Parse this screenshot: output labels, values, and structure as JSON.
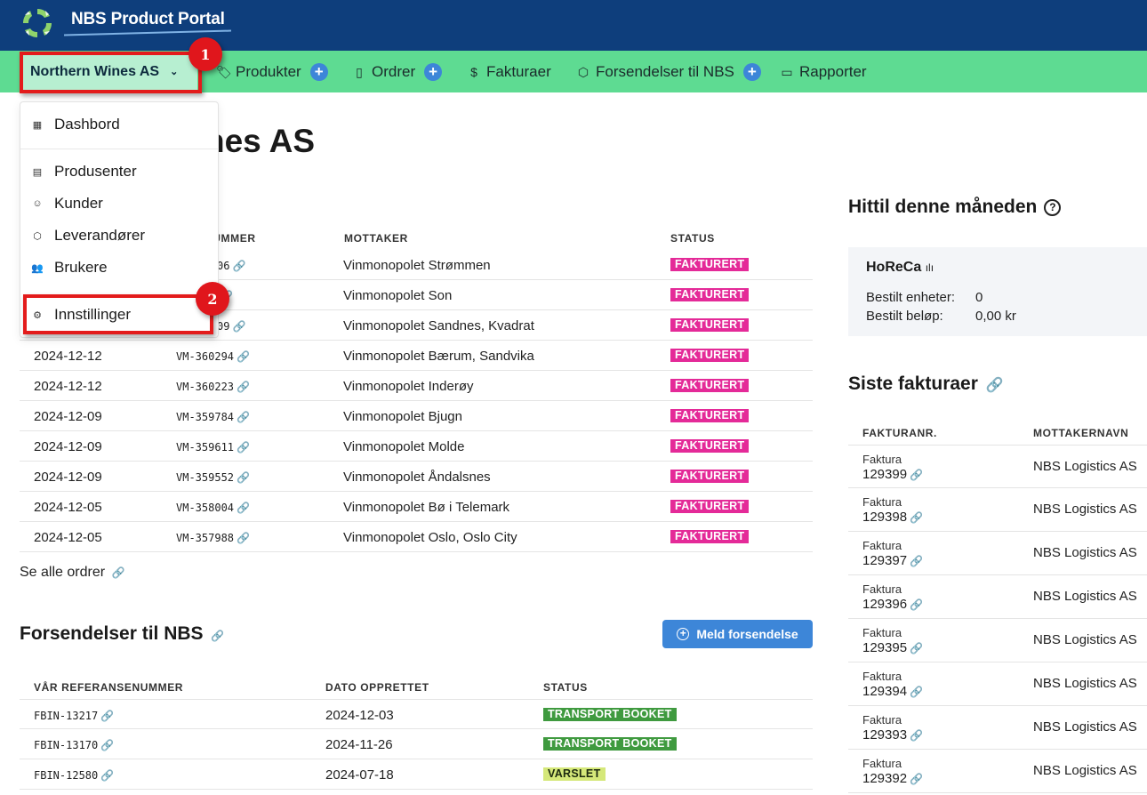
{
  "app": {
    "title": "NBS Product Portal"
  },
  "nav": {
    "org_selector": "Northern Wines AS",
    "items": [
      {
        "label": "Produkter",
        "icon": "tag-icon",
        "has_add": true
      },
      {
        "label": "Ordrer",
        "icon": "clipboard-icon",
        "has_add": true
      },
      {
        "label": "Fakturaer",
        "icon": "dollar-icon",
        "has_add": false
      },
      {
        "label": "Forsendelser til NBS",
        "icon": "box-icon",
        "has_add": true
      },
      {
        "label": "Rapporter",
        "icon": "book-icon",
        "has_add": false
      }
    ]
  },
  "dropdown": {
    "items": [
      {
        "label": "Dashbord",
        "icon": "grid-icon"
      },
      {
        "label": "Produsenter",
        "icon": "building-icon"
      },
      {
        "label": "Kunder",
        "icon": "smiley-icon"
      },
      {
        "label": "Leverandører",
        "icon": "cube-icon"
      },
      {
        "label": "Brukere",
        "icon": "users-icon"
      },
      {
        "label": "Innstillinger",
        "icon": "gear-icon"
      }
    ]
  },
  "annotations": {
    "badge1": "1",
    "badge2": "2"
  },
  "page": {
    "title": "Northern Wines AS",
    "title_visible": "nes AS"
  },
  "orders": {
    "headers": {
      "ref": "NUMMER",
      "recipient": "MOTTAKER",
      "status": "STATUS"
    },
    "rows": [
      {
        "date": "",
        "ref": "06",
        "recipient": "Vinmonopolet Strømmen",
        "status": "FAKTURERT"
      },
      {
        "date": "",
        "ref": "",
        "recipient": "Vinmonopolet Son",
        "status": "FAKTURERT"
      },
      {
        "date": "",
        "ref": "09",
        "recipient": "Vinmonopolet Sandnes, Kvadrat",
        "status": "FAKTURERT"
      },
      {
        "date": "2024-12-12",
        "ref": "VM-360294",
        "recipient": "Vinmonopolet Bærum, Sandvika",
        "status": "FAKTURERT"
      },
      {
        "date": "2024-12-12",
        "ref": "VM-360223",
        "recipient": "Vinmonopolet Inderøy",
        "status": "FAKTURERT"
      },
      {
        "date": "2024-12-09",
        "ref": "VM-359784",
        "recipient": "Vinmonopolet Bjugn",
        "status": "FAKTURERT"
      },
      {
        "date": "2024-12-09",
        "ref": "VM-359611",
        "recipient": "Vinmonopolet Molde",
        "status": "FAKTURERT"
      },
      {
        "date": "2024-12-09",
        "ref": "VM-359552",
        "recipient": "Vinmonopolet Åndalsnes",
        "status": "FAKTURERT"
      },
      {
        "date": "2024-12-05",
        "ref": "VM-358004",
        "recipient": "Vinmonopolet Bø i Telemark",
        "status": "FAKTURERT"
      },
      {
        "date": "2024-12-05",
        "ref": "VM-357988",
        "recipient": "Vinmonopolet Oslo, Oslo City",
        "status": "FAKTURERT"
      }
    ],
    "see_all": "Se alle ordrer"
  },
  "shipments": {
    "title": "Forsendelser til NBS",
    "button": "Meld forsendelse",
    "headers": {
      "ref": "VÅR REFERANSENUMMER",
      "date": "DATO OPPRETTET",
      "status": "STATUS"
    },
    "rows": [
      {
        "ref": "FBIN-13217",
        "date": "2024-12-03",
        "status": "TRANSPORT BOOKET"
      },
      {
        "ref": "FBIN-13170",
        "date": "2024-11-26",
        "status": "TRANSPORT BOOKET"
      },
      {
        "ref": "FBIN-12580",
        "date": "2024-07-18",
        "status": "VARSLET"
      }
    ]
  },
  "month": {
    "title": "Hittil denne måneden",
    "card": {
      "title": "HoReCa",
      "units_label": "Bestilt enheter:",
      "units_value": "0",
      "amount_label": "Bestilt beløp:",
      "amount_value": "0,00 kr"
    }
  },
  "invoices": {
    "title": "Siste fakturaer",
    "headers": {
      "number": "FAKTURANR.",
      "recipient": "MOTTAKERNAVN"
    },
    "rows": [
      {
        "label": "Faktura",
        "number": "129399",
        "recipient": "NBS Logistics AS"
      },
      {
        "label": "Faktura",
        "number": "129398",
        "recipient": "NBS Logistics AS"
      },
      {
        "label": "Faktura",
        "number": "129397",
        "recipient": "NBS Logistics AS"
      },
      {
        "label": "Faktura",
        "number": "129396",
        "recipient": "NBS Logistics AS"
      },
      {
        "label": "Faktura",
        "number": "129395",
        "recipient": "NBS Logistics AS"
      },
      {
        "label": "Faktura",
        "number": "129394",
        "recipient": "NBS Logistics AS"
      },
      {
        "label": "Faktura",
        "number": "129393",
        "recipient": "NBS Logistics AS"
      },
      {
        "label": "Faktura",
        "number": "129392",
        "recipient": "NBS Logistics AS"
      }
    ]
  },
  "colors": {
    "header": "#0e3e7c",
    "nav": "#5edb92",
    "accent": "#3d86d8",
    "status_invoiced": "#e42a98",
    "status_booked": "#3f9a3f",
    "status_notified": "#d5e87a",
    "highlight": "#e31b1b"
  }
}
